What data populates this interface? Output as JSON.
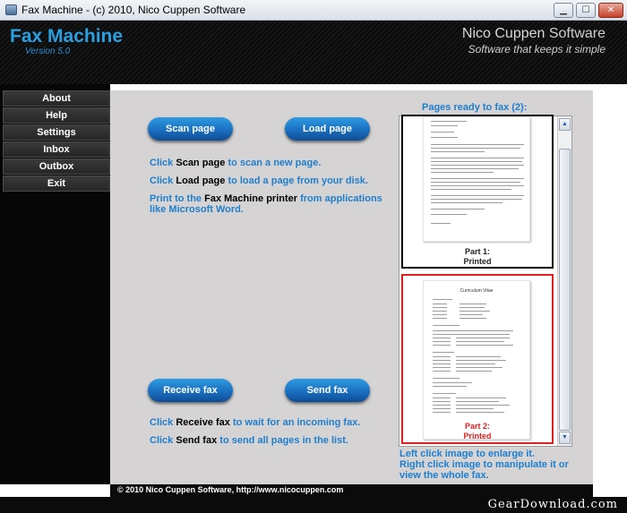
{
  "window": {
    "title": "Fax Machine  -  (c) 2010, Nico Cuppen Software",
    "controls": {
      "minimize": "▁",
      "maximize": "☐",
      "close": "✕"
    }
  },
  "header": {
    "app_name": "Fax Machine",
    "version": "Version 5.0",
    "brand_owner": "Nico Cuppen",
    "brand_suffix": "Software",
    "tagline": "Software that keeps it simple"
  },
  "nav": {
    "items": [
      {
        "label": "About"
      },
      {
        "label": "Help"
      },
      {
        "label": "Settings"
      },
      {
        "label": "Inbox"
      },
      {
        "label": "Outbox"
      },
      {
        "label": "Exit"
      }
    ]
  },
  "actions": {
    "scan": "Scan page",
    "load": "Load page",
    "receive": "Receive fax",
    "send": "Send fax"
  },
  "hints": {
    "scan_pre": "Click",
    "scan_key": "Scan page",
    "scan_post": "to scan a new page.",
    "load_pre": "Click",
    "load_key": "Load page",
    "load_post": "to load a page from your disk.",
    "print_pre": "Print to the",
    "print_key": "Fax Machine printer",
    "print_post": "from applications",
    "print_line2": "like Microsoft Word.",
    "receive_pre": "Click",
    "receive_key": "Receive fax",
    "receive_post": "to wait for an incoming fax.",
    "send_pre": "Click",
    "send_key": "Send fax",
    "send_post": "to send all pages in the list."
  },
  "pages": {
    "title": "Pages ready to fax (2):",
    "items": [
      {
        "part": "Part 1:",
        "status": "Printed",
        "selected": false
      },
      {
        "part": "Part 2:",
        "status": "Printed",
        "selected": true
      }
    ],
    "page2_heading": "Curriculum Vitae"
  },
  "help": {
    "line1": "Left click image to enlarge it.",
    "line2": "Right click image to manipulate it or",
    "line3": "view the whole fax."
  },
  "footer": {
    "copyright": "© 2010 Nico Cuppen Software, http://www.nicocuppen.com"
  },
  "watermark": "GearDownload.com",
  "colors": {
    "accent_blue": "#1d7fcf",
    "button_blue": "#1a6fc0",
    "selected_border": "#e02020",
    "main_bg": "#d5d3d3"
  }
}
